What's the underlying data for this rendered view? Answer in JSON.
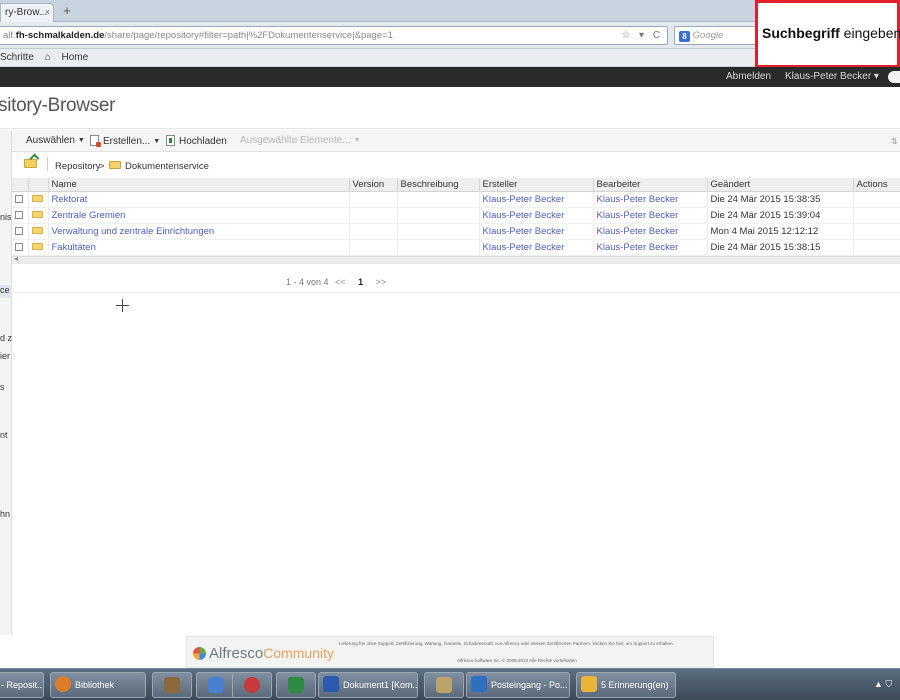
{
  "browser": {
    "tab_title": "ry-Brow...",
    "tab_close": "×",
    "new_tab": "+",
    "url_prefix": "alf.",
    "url_host": "fh-schmalkalden.de",
    "url_path": "/share/page/repository#filter=path|%2FDokumentenservice|&page=1",
    "url_icons": "☆ ▾ C",
    "search_engine_icon": "8",
    "search_engine_name": "Google",
    "bookmarks": [
      "Schritte",
      "Home"
    ],
    "home_icon": "⌂"
  },
  "search_hint": {
    "bold": "Suchbegriff",
    "rest": " eingeben"
  },
  "header": {
    "logout": "Abmelden",
    "user": "Klaus-Peter Becker ▾"
  },
  "page": {
    "title": "sitory-Browser"
  },
  "sidebar": {
    "fragments": [
      "nis",
      "ce",
      "d z",
      "ier",
      "s",
      "nt",
      "hn"
    ]
  },
  "toolbar": {
    "select": "Auswählen",
    "create": "Erstellen...",
    "upload": "Hochladen",
    "selected_items": "Ausgewählte Elemente...",
    "caret": "▼",
    "scroll_icon": "⇅"
  },
  "breadcrumb": {
    "root": "Repository",
    "separator": ">",
    "current": "Dokumentenservice"
  },
  "table": {
    "columns": [
      "Name",
      "Version",
      "Beschreibung",
      "Ersteller",
      "Bearbeiter",
      "Geändert",
      "Actions"
    ],
    "rows": [
      {
        "name": "Rektorat",
        "version": "",
        "description": "",
        "creator": "Klaus-Peter Becker",
        "modifier": "Klaus-Peter Becker",
        "modified": "Die 24 Mär 2015 15:38:35"
      },
      {
        "name": "Zentrale Gremien",
        "version": "",
        "description": "",
        "creator": "Klaus-Peter Becker",
        "modifier": "Klaus-Peter Becker",
        "modified": "Die 24 Mär 2015 15:39:04"
      },
      {
        "name": "Verwaltung und zentrale Einrichtungen",
        "version": "",
        "description": "",
        "creator": "Klaus-Peter Becker",
        "modifier": "Klaus-Peter Becker",
        "modified": "Mon 4 Mai 2015 12:12:12"
      },
      {
        "name": "Fakultäten",
        "version": "",
        "description": "",
        "creator": "Klaus-Peter Becker",
        "modifier": "Klaus-Peter Becker",
        "modified": "Die 24 Mär 2015 15:38:15"
      }
    ],
    "scroll_left": "◂"
  },
  "pager": {
    "range": "1 - 4 von 4",
    "prev": "<<",
    "current": "1",
    "next": ">>"
  },
  "footer": {
    "brand": "Alfresco",
    "brand_suffix": "Community",
    "legal": "Lieferung frei ohne Support, Zertifizierung, Wartung, Garantie, Schadenersatz von Alfresco oder dessen Zertifizierten Partnern. Klicken Sie hier, um Support zu erhalten.",
    "copyright": "Alfresco Software Inc. © 2005-2013 Alle Rechte vorbehalten"
  },
  "taskbar": {
    "items": [
      {
        "label": "- Reposit...",
        "color": "#3d6fb0"
      },
      {
        "label": "Bibliothek",
        "color": "#e07b2a"
      },
      {
        "label": "",
        "color": "#8a6a3c"
      },
      {
        "label": "",
        "color": "#4a7fd0"
      },
      {
        "label": "",
        "color": "#c73a3a"
      },
      {
        "label": "",
        "color": "#2f8a45"
      },
      {
        "label": "Dokument1 [Kom...",
        "color": "#2b5bb0"
      },
      {
        "label": "",
        "color": "#b9a36a"
      },
      {
        "label": "Posteingang - Po...",
        "color": "#2e6fc0"
      },
      {
        "label": "5 Erinnerung(en)",
        "color": "#e8b53a"
      }
    ],
    "tray": "▲ ⛉"
  },
  "colors": {
    "link": "#4a5fb8",
    "header_bg": "#2a2a2a",
    "hint_border": "#e0202a"
  }
}
